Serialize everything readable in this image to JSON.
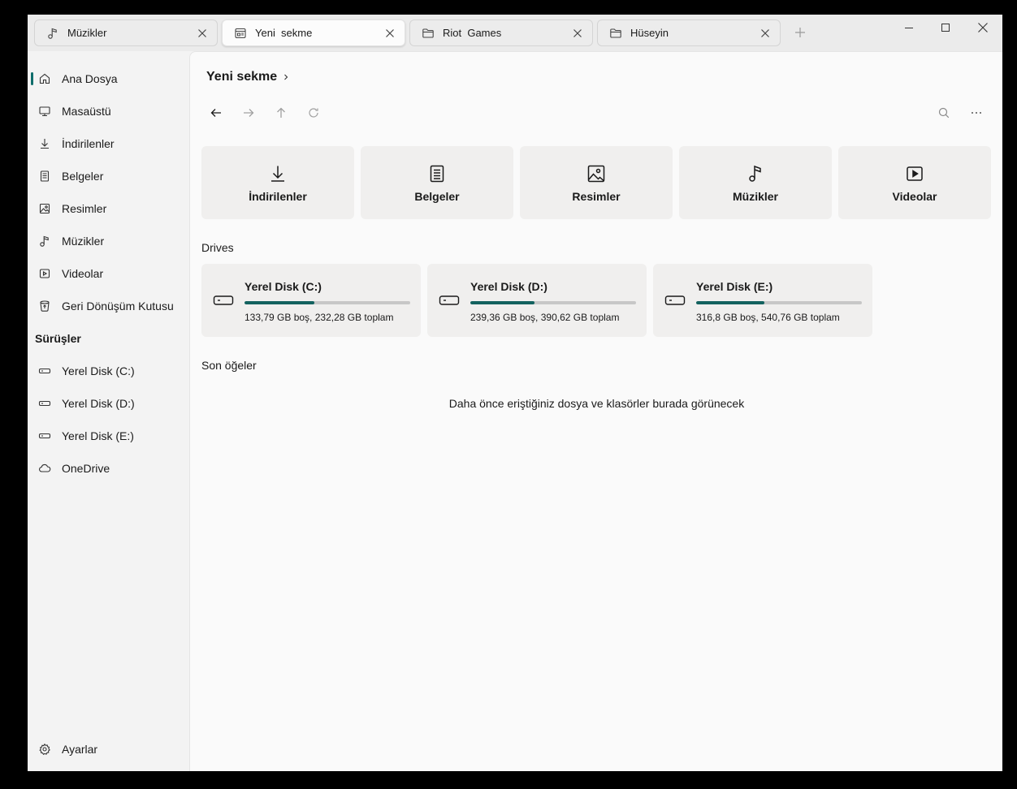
{
  "tabs": [
    {
      "label": "Müzikler",
      "icon": "music-icon"
    },
    {
      "label": "Yeni  sekme",
      "icon": "new-tab-icon"
    },
    {
      "label": "Riot  Games",
      "icon": "folder-icon"
    },
    {
      "label": "Hüseyin",
      "icon": "folder-icon"
    }
  ],
  "sidebar": {
    "items": [
      {
        "label": "Ana Dosya",
        "icon": "home-icon"
      },
      {
        "label": "Masaüstü",
        "icon": "desktop-icon"
      },
      {
        "label": "İndirilenler",
        "icon": "download-icon"
      },
      {
        "label": "Belgeler",
        "icon": "document-icon"
      },
      {
        "label": "Resimler",
        "icon": "image-icon"
      },
      {
        "label": "Müzikler",
        "icon": "music-icon"
      },
      {
        "label": "Videolar",
        "icon": "video-icon"
      },
      {
        "label": "Geri Dönüşüm Kutusu",
        "icon": "recycle-bin-icon"
      }
    ],
    "drives_header": "Sürüşler",
    "drives": [
      {
        "label": "Yerel Disk (C:)",
        "icon": "drive-icon"
      },
      {
        "label": "Yerel Disk (D:)",
        "icon": "drive-icon"
      },
      {
        "label": "Yerel Disk (E:)",
        "icon": "drive-icon"
      },
      {
        "label": "OneDrive",
        "icon": "cloud-icon"
      }
    ],
    "settings": {
      "label": "Ayarlar",
      "icon": "gear-icon"
    }
  },
  "main": {
    "breadcrumb": "Yeni sekme",
    "quick_access": [
      {
        "label": "İndirilenler",
        "icon": "download-icon"
      },
      {
        "label": "Belgeler",
        "icon": "document-icon"
      },
      {
        "label": "Resimler",
        "icon": "image-icon"
      },
      {
        "label": "Müzikler",
        "icon": "music-icon"
      },
      {
        "label": "Videolar",
        "icon": "video-icon"
      }
    ],
    "drives_title": "Drives",
    "drives": [
      {
        "name": "Yerel Disk (C:)",
        "info": "133,79 GB boş, 232,28 GB toplam",
        "used_fraction": 0.424
      },
      {
        "name": "Yerel Disk (D:)",
        "info": "239,36 GB boş, 390,62 GB toplam",
        "used_fraction": 0.387
      },
      {
        "name": "Yerel Disk (E:)",
        "info": "316,8 GB boş, 540,76 GB toplam",
        "used_fraction": 0.414
      }
    ],
    "recent_title": "Son öğeler",
    "recent_empty": "Daha önce eriştiğiniz dosya ve klasörler burada görünecek"
  },
  "colors": {
    "accent": "#0f6d6b",
    "drive_fill": "#13625f",
    "card_bg": "#f0efee"
  }
}
